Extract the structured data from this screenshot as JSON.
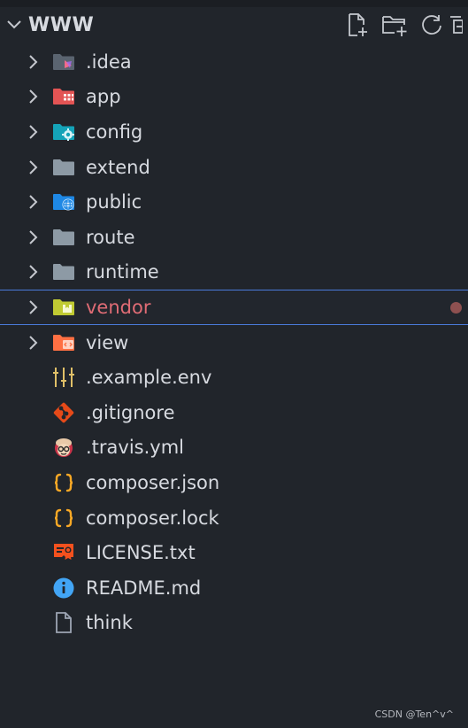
{
  "header": {
    "title": "WWW"
  },
  "tree": {
    "items": [
      {
        "label": ".idea",
        "kind": "folder",
        "icon": "idea-folder-icon",
        "color": "#5a6470"
      },
      {
        "label": "app",
        "kind": "folder",
        "icon": "app-folder-icon",
        "color": "#e35454"
      },
      {
        "label": "config",
        "kind": "folder",
        "icon": "config-folder-icon",
        "color": "#14a3b8"
      },
      {
        "label": "extend",
        "kind": "folder",
        "icon": "folder-icon",
        "color": "#8d9aa5"
      },
      {
        "label": "public",
        "kind": "folder",
        "icon": "public-folder-icon",
        "color": "#1e88e5"
      },
      {
        "label": "route",
        "kind": "folder",
        "icon": "folder-icon",
        "color": "#8d9aa5"
      },
      {
        "label": "runtime",
        "kind": "folder",
        "icon": "folder-icon",
        "color": "#8d9aa5"
      },
      {
        "label": "vendor",
        "kind": "folder",
        "icon": "vendor-folder-icon",
        "color": "#c0ca33",
        "selected": true,
        "modified": true
      },
      {
        "label": "view",
        "kind": "folder",
        "icon": "view-folder-icon",
        "color": "#ff7043"
      },
      {
        "label": ".example.env",
        "kind": "file",
        "icon": "env-settings-icon",
        "color": "#e0c068"
      },
      {
        "label": ".gitignore",
        "kind": "file",
        "icon": "git-icon",
        "color": "#e64a19"
      },
      {
        "label": ".travis.yml",
        "kind": "file",
        "icon": "travis-icon",
        "color": "#cb3349"
      },
      {
        "label": "composer.json",
        "kind": "file",
        "icon": "json-braces-icon",
        "color": "#f9a825"
      },
      {
        "label": "composer.lock",
        "kind": "file",
        "icon": "json-braces-icon",
        "color": "#f9a825"
      },
      {
        "label": "LICENSE.txt",
        "kind": "file",
        "icon": "license-icon",
        "color": "#f4511e"
      },
      {
        "label": "README.md",
        "kind": "file",
        "icon": "info-icon",
        "color": "#42a5f5"
      },
      {
        "label": "think",
        "kind": "file",
        "icon": "file-icon",
        "color": "#9da5b4"
      }
    ]
  },
  "watermark": "CSDN @Ten^v^"
}
